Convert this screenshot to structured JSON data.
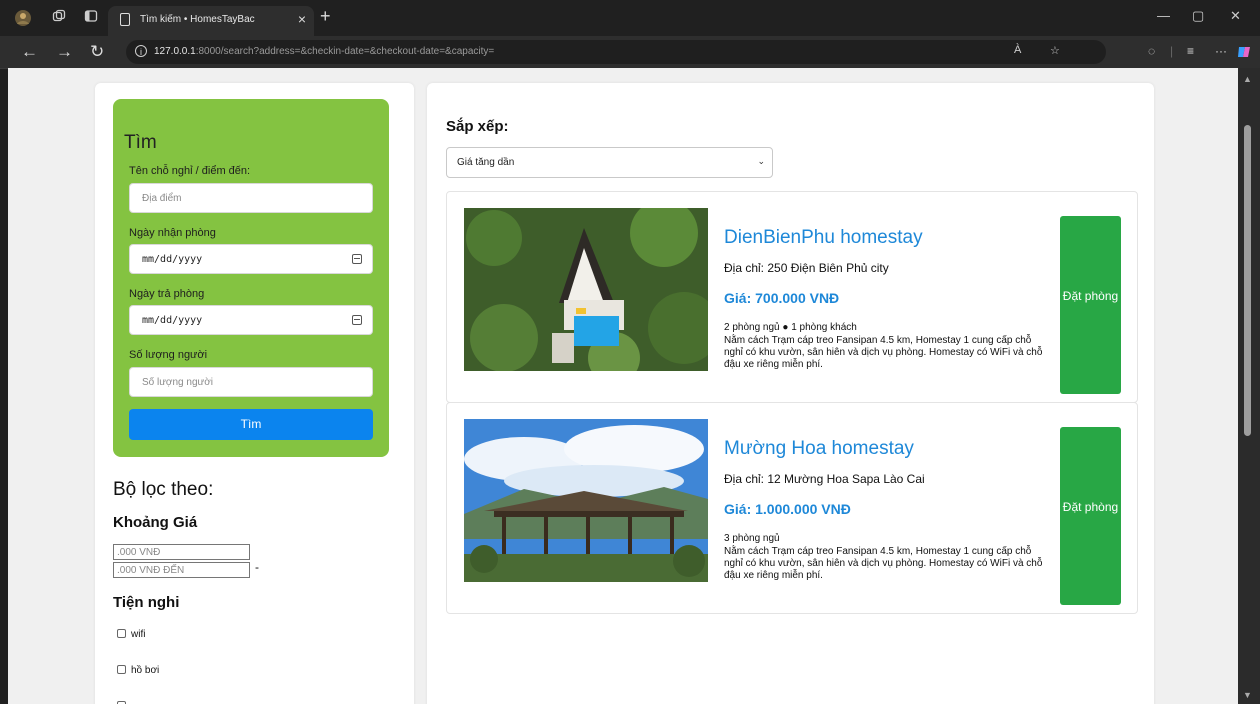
{
  "browser": {
    "tab_title": "Tìm kiếm • HomesTayBac",
    "url_host": "127.0.0.1",
    "url_rest": ":8000/search?address=&checkin-date=&checkout-date=&capacity=",
    "read_aloud": "À"
  },
  "search": {
    "title": "Tìm",
    "destination_label": "Tên chỗ nghỉ / điểm đến:",
    "destination_placeholder": "Địa điểm",
    "checkin_label": "Ngày nhận phòng",
    "checkin_value": "mm/dd/yyyy",
    "checkout_label": "Ngày trả phòng",
    "checkout_value": "mm/dd/yyyy",
    "capacity_label": "Số lượng người",
    "capacity_placeholder": "Số lượng người",
    "button": "Tìm"
  },
  "filters": {
    "title": "Bộ lọc theo:",
    "price_title": "Khoảng Giá",
    "price_from_placeholder": ".000 VNĐ",
    "price_to_placeholder": ".000 VNĐ ĐẾN",
    "dash": "-",
    "amenities_title": "Tiện nghi",
    "amenities": [
      "wifi",
      "hồ bơi"
    ]
  },
  "sort": {
    "title": "Sắp xếp:",
    "selected": "Giá tăng dần"
  },
  "listings": [
    {
      "name": "DienBienPhu homestay",
      "address": "Địa chỉ: 250 Điện Biên Phủ city",
      "price": "Giá: 700.000 VNĐ",
      "rooms": "2 phòng ngủ ● 1 phòng khách",
      "description": "Nằm cách Trạm cáp treo Fansipan 4.5 km, Homestay 1 cung cấp chỗ nghỉ có khu vườn, sân hiên và dịch vụ phòng. Homestay có WiFi và chỗ đậu xe riêng miễn phí.",
      "book_label": "Đặt phòng"
    },
    {
      "name": "Mường Hoa homestay",
      "address": "Địa chỉ: 12 Mường Hoa Sapa Lào Cai",
      "price": "Giá: 1.000.000 VNĐ",
      "rooms": "3 phòng ngủ",
      "description": "Nằm cách Trạm cáp treo Fansipan 4.5 km, Homestay 1 cung cấp chỗ nghỉ có khu vườn, sân hiên và dịch vụ phòng. Homestay có WiFi và chỗ đậu xe riêng miễn phí.",
      "book_label": "Đặt phòng"
    }
  ],
  "icons": {
    "profile": "profile-icon",
    "workspaces": "workspaces-icon",
    "tab_actions": "tab-actions-icon",
    "calendar": "calendar-icon",
    "chevron": "chevron-down-icon"
  },
  "colors": {
    "search_box": "#84c341",
    "primary_button": "#0b84ee",
    "book_button": "#28a745",
    "link_blue": "#1e88d8"
  }
}
